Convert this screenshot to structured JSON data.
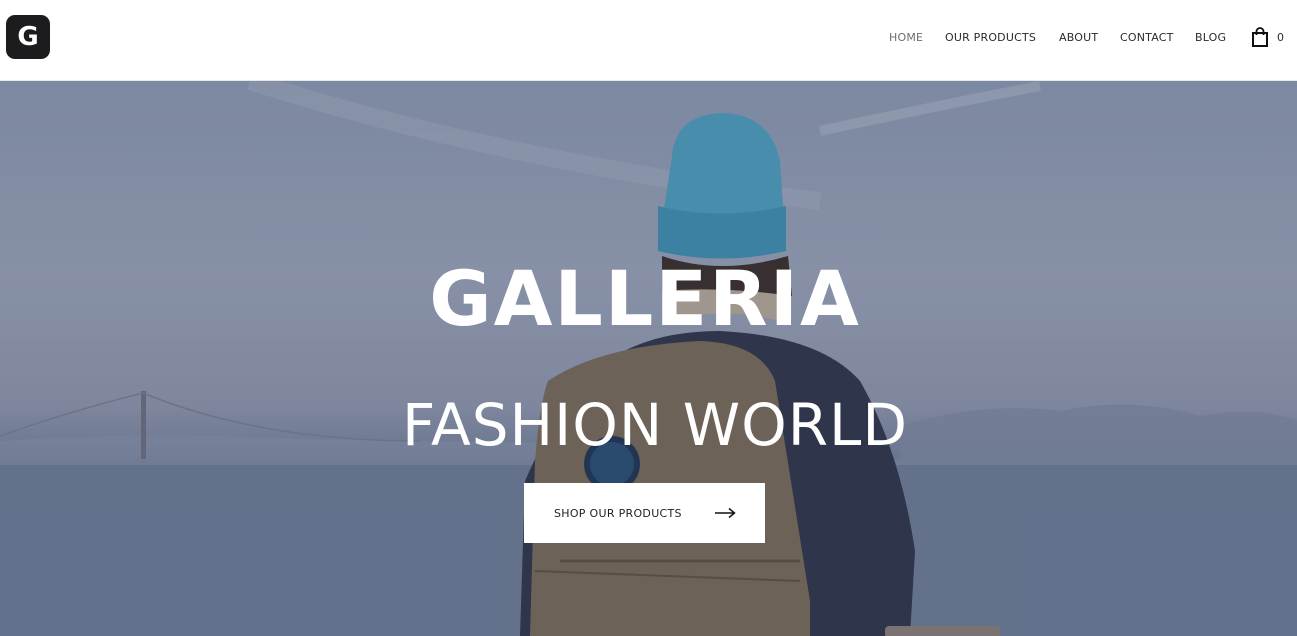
{
  "brand": {
    "logo_letter": "G"
  },
  "nav": {
    "items": [
      {
        "label": "HOME",
        "active": true
      },
      {
        "label": "OUR PRODUCTS",
        "active": false
      },
      {
        "label": "ABOUT",
        "active": false
      },
      {
        "label": "CONTACT",
        "active": false
      },
      {
        "label": "BLOG",
        "active": false
      }
    ],
    "cart": {
      "icon": "shopping-bag-icon",
      "count": "0"
    }
  },
  "hero": {
    "title": "GALLERIA",
    "subtitle": "FASHION WORLD",
    "cta": {
      "label": "SHOP OUR PRODUCTS",
      "icon": "arrow-right-icon"
    }
  },
  "colors": {
    "header_bg": "#ffffff",
    "logo_bg": "#1c1c1e",
    "nav_text": "#2b2b2b",
    "nav_active": "#6d6d6d",
    "hero_text": "#ffffff",
    "cta_bg": "#ffffff"
  }
}
